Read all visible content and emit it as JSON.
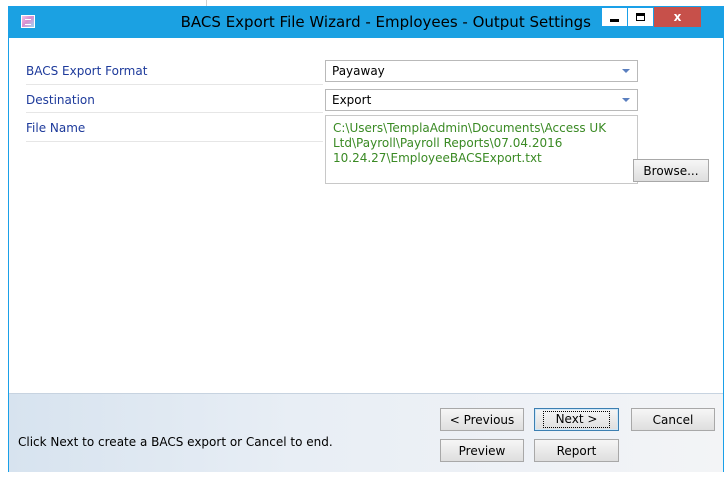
{
  "window": {
    "title": "BACS Export File Wizard - Employees - Output Settings",
    "close_glyph": "x"
  },
  "fields": {
    "format": {
      "label": "BACS Export Format",
      "value": "Payaway"
    },
    "destination": {
      "label": "Destination",
      "value": "Export"
    },
    "file_name": {
      "label": "File Name",
      "value": "C:\\Users\\TemplaAdmin\\Documents\\Access UK\nLtd\\Payroll\\Payroll Reports\\07.04.2016\n10.24.27\\EmployeeBACSExport.txt"
    },
    "browse_label": "Browse..."
  },
  "footer": {
    "hint": "Click Next to create a BACS export or Cancel to end.",
    "previous_label": "< Previous",
    "next_label": "Next >",
    "cancel_label": "Cancel",
    "preview_label": "Preview",
    "report_label": "Report"
  },
  "colors": {
    "titlebar": "#1ba1e2",
    "label_text": "#1d3a9b",
    "path_text": "#3a8a24",
    "close_button": "#c7504a"
  },
  "icons": {
    "app": "wizard-app-icon",
    "minimize": "minimize-icon",
    "maximize": "maximize-icon",
    "close": "close-icon",
    "dropdown": "chevron-down-icon"
  }
}
